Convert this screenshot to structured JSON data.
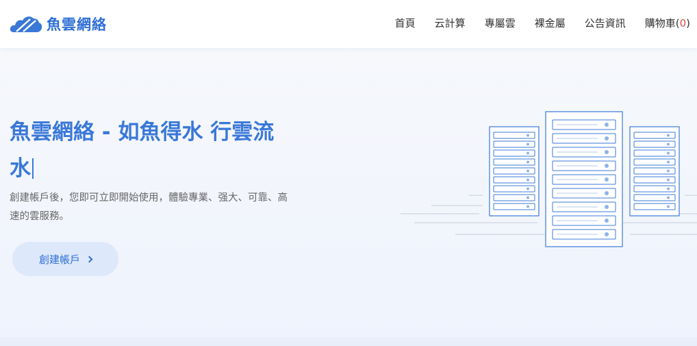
{
  "brand": {
    "name": "魚雲網絡",
    "logo_icon": "cloud-icon",
    "color": "#2f6fd6"
  },
  "nav": {
    "items": [
      {
        "label": "首頁"
      },
      {
        "label": "云計算"
      },
      {
        "label": "專屬雲"
      },
      {
        "label": "裸金屬"
      },
      {
        "label": "公告資訊"
      }
    ],
    "cart": {
      "label": "購物車(",
      "count": "0",
      "close": ")"
    }
  },
  "hero": {
    "headline_line1": "魚雲網絡 - 如魚得水 行雲流",
    "headline_line2": "水",
    "subtext": "創建帳戶後，您即可立即開始使用，體驗專業、强大、可靠、高速的雲服務。",
    "cta_label": "創建帳戶",
    "cta_icon": "chevron-right-icon",
    "illustration_icon": "server-rack-icon"
  },
  "colors": {
    "accent": "#3a78d8",
    "cart_count": "#e14b4b",
    "cta_bg": "#dde8fb"
  }
}
